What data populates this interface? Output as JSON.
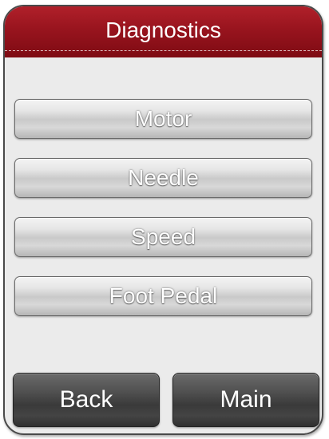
{
  "header": {
    "title": "Diagnostics"
  },
  "menu": {
    "items": [
      {
        "label": "Motor"
      },
      {
        "label": "Needle"
      },
      {
        "label": "Speed"
      },
      {
        "label": "Foot Pedal"
      }
    ]
  },
  "nav": {
    "back_label": "Back",
    "main_label": "Main"
  },
  "colors": {
    "header_red": "#98141e",
    "panel_background": "#ebebeb",
    "nav_button_dark": "#444444"
  }
}
